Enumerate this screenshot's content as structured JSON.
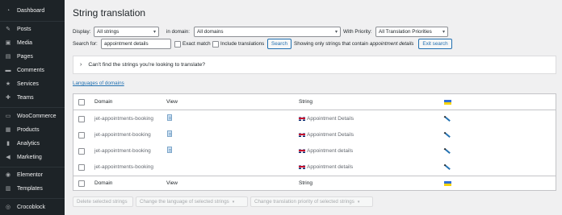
{
  "sidebar": {
    "items": [
      {
        "label": "Dashboard",
        "icon": "dashboard-icon",
        "glyph": "◔"
      },
      {
        "label": "Posts",
        "icon": "pin-icon",
        "glyph": "✎"
      },
      {
        "label": "Media",
        "icon": "media-icon",
        "glyph": "▣"
      },
      {
        "label": "Pages",
        "icon": "pages-icon",
        "glyph": "▤"
      },
      {
        "label": "Comments",
        "icon": "comments-icon",
        "glyph": "▬"
      },
      {
        "label": "Services",
        "icon": "services-icon",
        "glyph": "★"
      },
      {
        "label": "Teams",
        "icon": "teams-icon",
        "glyph": "✚"
      },
      {
        "label": "WooCommerce",
        "icon": "woocommerce-icon",
        "glyph": "▭"
      },
      {
        "label": "Products",
        "icon": "products-icon",
        "glyph": "▦"
      },
      {
        "label": "Analytics",
        "icon": "analytics-icon",
        "glyph": "▮"
      },
      {
        "label": "Marketing",
        "icon": "marketing-icon",
        "glyph": "◀"
      },
      {
        "label": "Elementor",
        "icon": "elementor-icon",
        "glyph": "◉"
      },
      {
        "label": "Templates",
        "icon": "templates-icon",
        "glyph": "▥"
      },
      {
        "label": "Crocoblock",
        "icon": "crocoblock-icon",
        "glyph": "◎"
      }
    ]
  },
  "page": {
    "title": "String translation"
  },
  "filters": {
    "display_label": "Display:",
    "display_value": "All strings",
    "domain_label": "in domain:",
    "domain_value": "All domains",
    "priority_label": "With Priority:",
    "priority_value": "All Translation Priorities",
    "search_label": "Search for:",
    "search_value": "appointment details",
    "exact_match_label": "Exact match",
    "include_translations_label": "Include translations",
    "search_button": "Search",
    "showing_text": "Showing only strings that contain",
    "showing_term": "appointment details",
    "exit_search_button": "Exit search"
  },
  "accordion": {
    "label": "Can't find the strings you're looking to translate?"
  },
  "languages_link": "Languages of domains",
  "table": {
    "columns": {
      "domain": "Domain",
      "view": "View",
      "string": "String"
    },
    "rows": [
      {
        "domain": "jet-appointments-booking",
        "has_view": true,
        "string": "Appointment Details"
      },
      {
        "domain": "jet-appointment-booking",
        "has_view": true,
        "string": "Appointment Details"
      },
      {
        "domain": "jet-appointment-booking",
        "has_view": true,
        "string": "Appointment details"
      },
      {
        "domain": "jet-appointments-booking",
        "has_view": false,
        "string": "Appointment details"
      }
    ]
  },
  "bulk_actions": {
    "delete": "Delete selected strings",
    "change_language": "Change the language of selected strings",
    "change_priority": "Change translation priority of selected strings"
  },
  "colors": {
    "sidebar_bg": "#1d2327",
    "accent": "#2271b1",
    "page_bg": "#f0f0f1"
  }
}
